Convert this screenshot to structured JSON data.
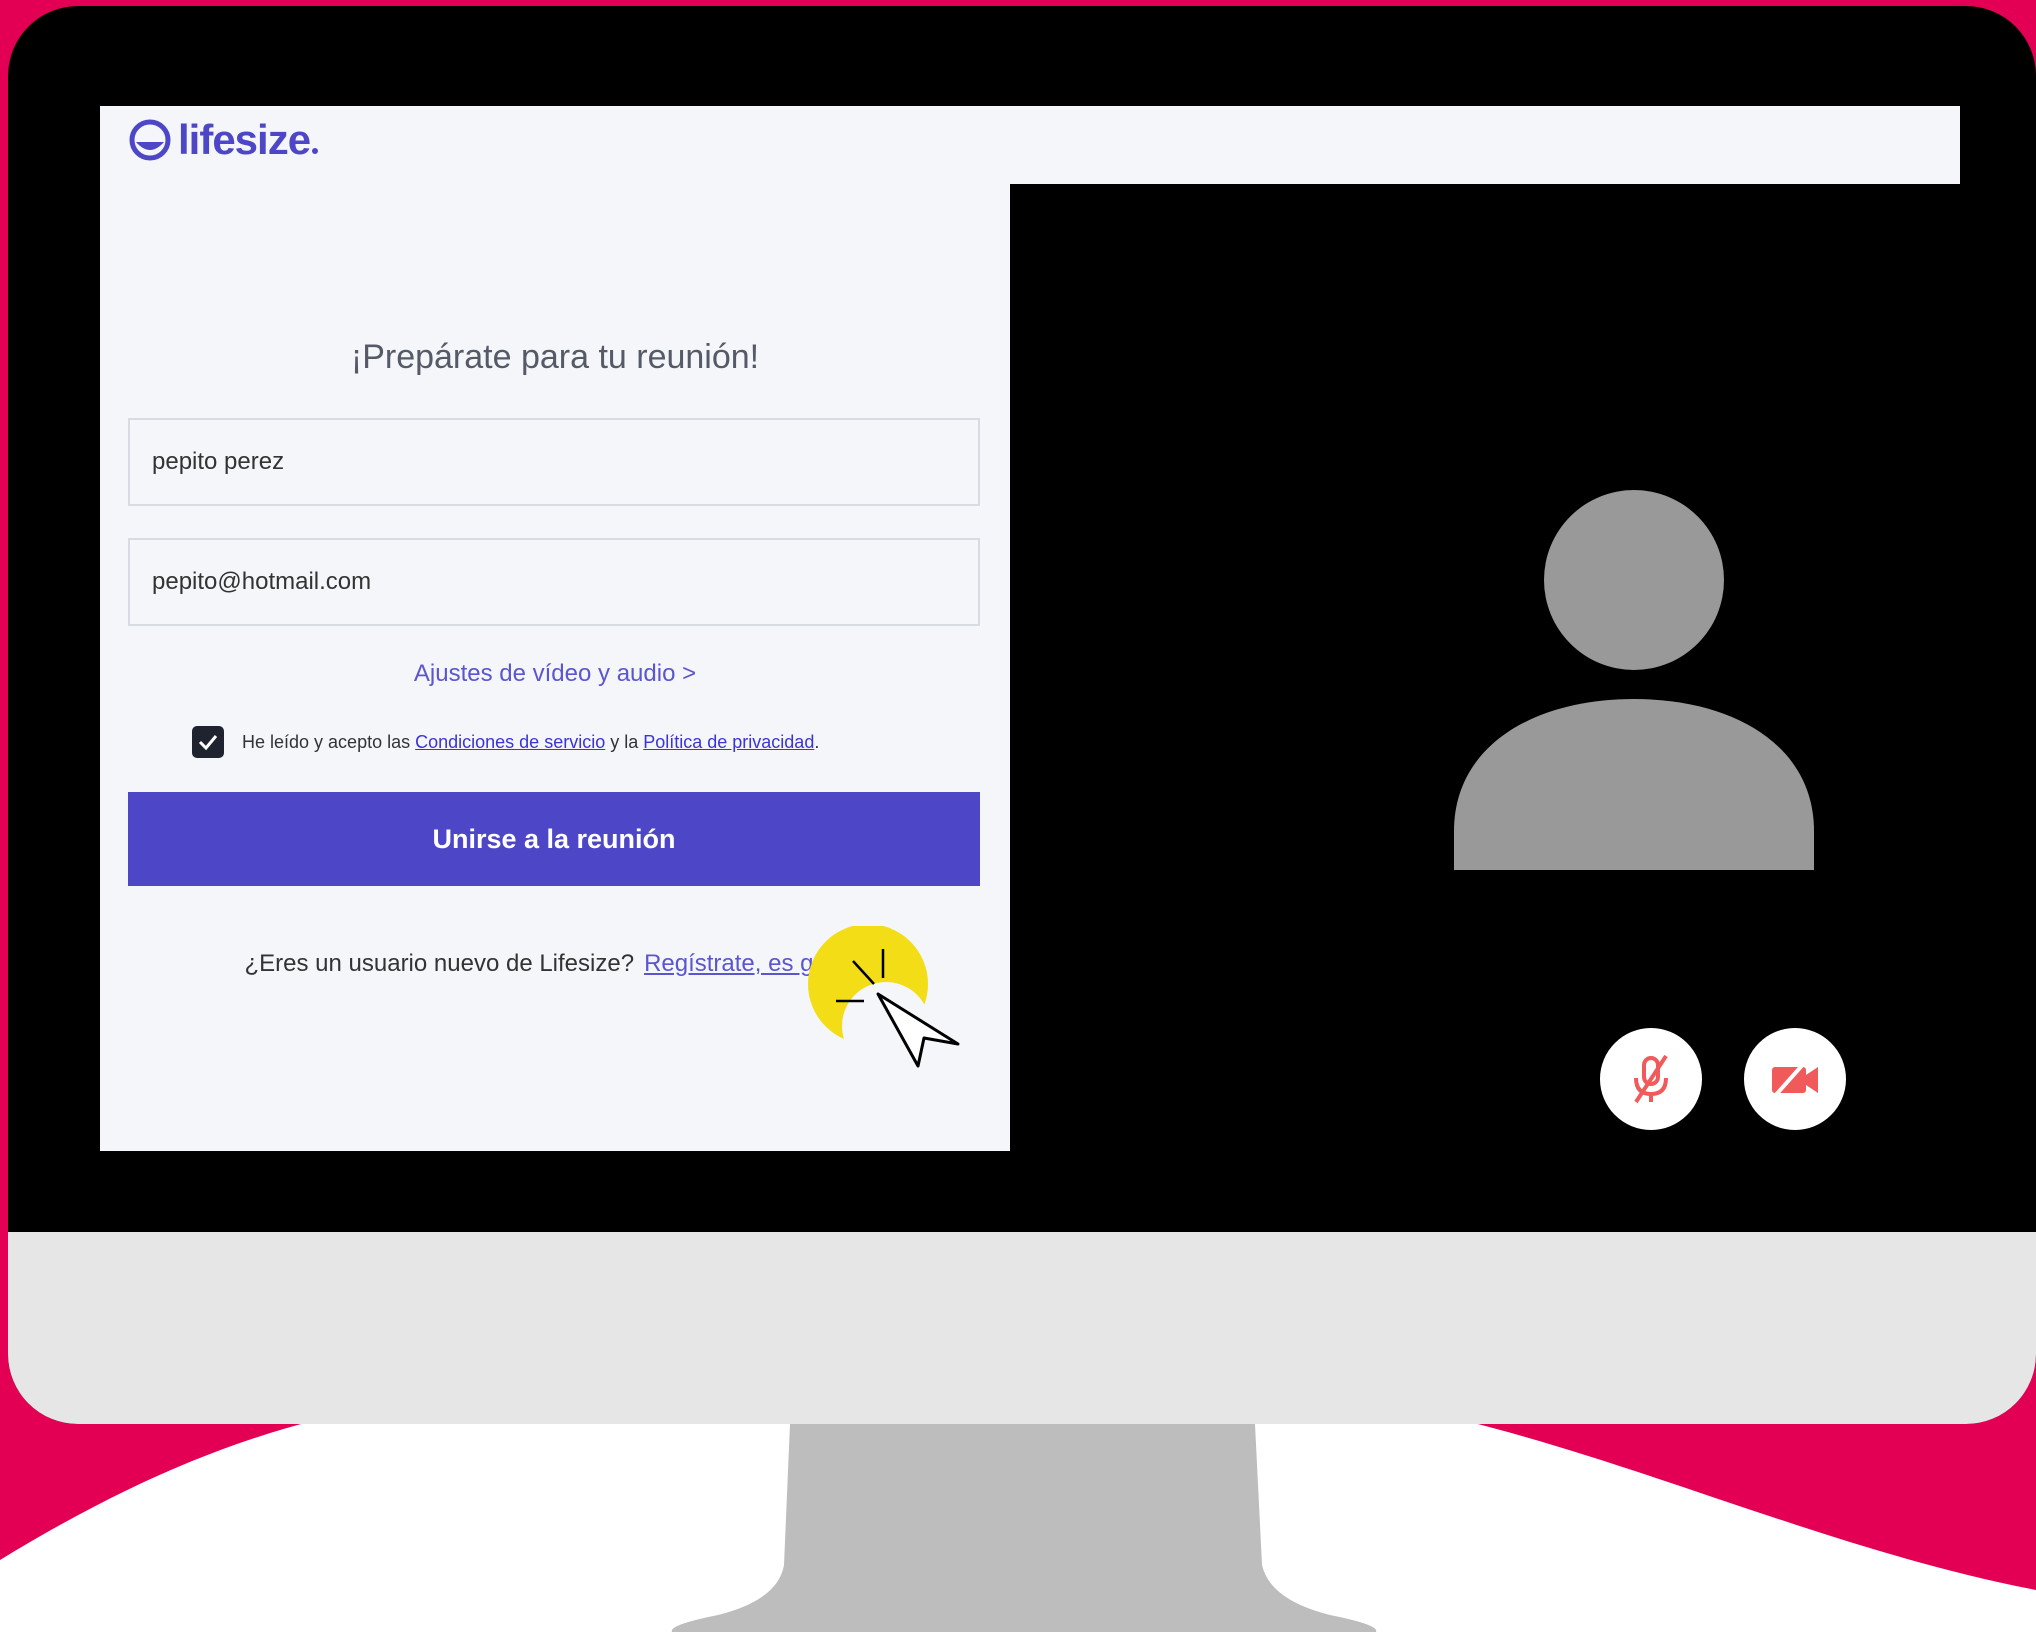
{
  "colors": {
    "background": "#e30054",
    "accent": "#4d47c8",
    "screen_black": "#000000",
    "chin": "#e6e6e6",
    "stand": "#bdbdbd"
  },
  "app": {
    "logo_text": "lifesize"
  },
  "form": {
    "title": "¡Prepárate para tu reunión!",
    "name_value": "pepito perez",
    "email_value": "pepito@hotmail.com",
    "settings_link": "Ajustes de vídeo y audio >",
    "terms": {
      "checked": true,
      "prefix": "He leído y acepto las ",
      "terms_link": "Condiciones de servicio",
      "middle": " y la ",
      "privacy_link": "Política de privacidad",
      "suffix": "."
    },
    "join_button": "Unirse a la reunión",
    "new_user_text": "¿Eres un usuario nuevo de Lifesize?",
    "register_link": "Regístrate, es gratis."
  },
  "video": {
    "avatar_icon": "user-silhouette-icon",
    "mic_icon": "mic-muted-icon",
    "camera_icon": "camera-off-icon"
  },
  "cursor_icon": "pointer-cursor-icon"
}
